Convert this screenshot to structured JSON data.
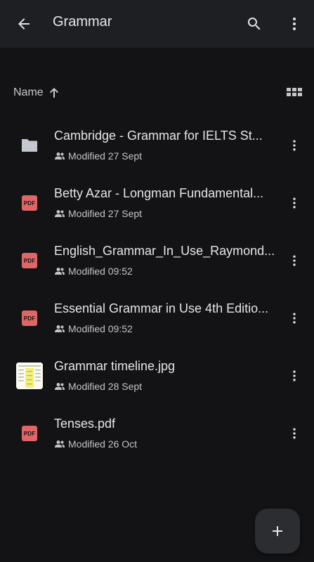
{
  "header": {
    "title": "Grammar",
    "icons": {
      "back": "arrow-left-icon",
      "search": "search-icon",
      "more": "more-vert-icon"
    }
  },
  "sort": {
    "label": "Name",
    "direction": "ascending",
    "view_toggle_icon": "grid-view-icon"
  },
  "files": [
    {
      "name": "Cambridge - Grammar for IELTS St...",
      "modified": "Modified 27 Sept",
      "type": "folder",
      "shared": true
    },
    {
      "name": "Betty Azar - Longman Fundamental...",
      "modified": "Modified 27 Sept",
      "type": "pdf",
      "shared": true
    },
    {
      "name": "English_Grammar_In_Use_Raymond...",
      "modified": "Modified 09:52",
      "type": "pdf",
      "shared": true
    },
    {
      "name": "Essential Grammar in Use 4th Editio...",
      "modified": "Modified 09:52",
      "type": "pdf",
      "shared": true
    },
    {
      "name": "Grammar timeline.jpg",
      "modified": "Modified 28 Sept",
      "type": "image",
      "shared": true
    },
    {
      "name": "Tenses.pdf",
      "modified": "Modified 26 Oct",
      "type": "pdf",
      "shared": true
    }
  ],
  "pdf_badge_label": "PDF",
  "fab": {
    "icon": "plus-icon"
  },
  "colors": {
    "background": "#131316",
    "topbar": "#1e1f23",
    "pdf": "#e06666",
    "folder": "#c4c7cf",
    "fab": "#2c2d31"
  }
}
